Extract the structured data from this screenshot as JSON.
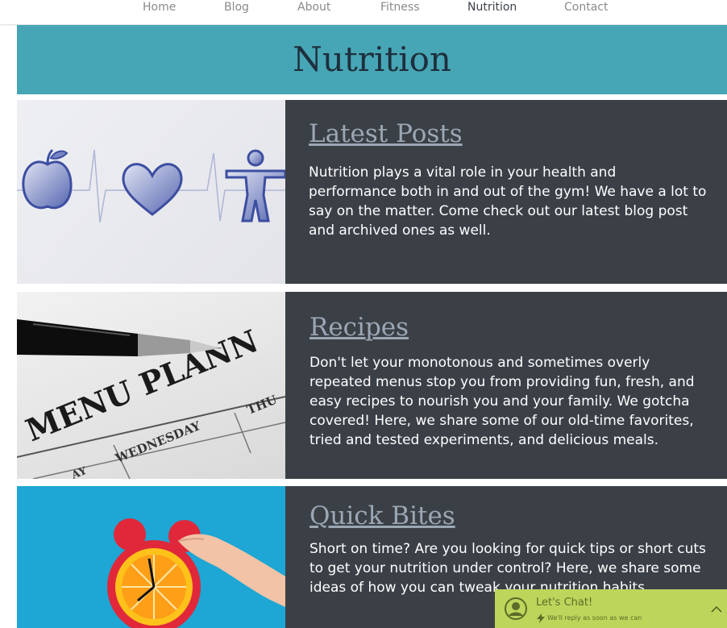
{
  "nav": {
    "items": [
      {
        "label": "Home"
      },
      {
        "label": "Blog"
      },
      {
        "label": "About"
      },
      {
        "label": "Fitness"
      },
      {
        "label": "Nutrition"
      },
      {
        "label": "Contact"
      }
    ],
    "active": "Nutrition"
  },
  "banner": {
    "title": "Nutrition"
  },
  "sections": [
    {
      "title": "Latest Posts",
      "description": "Nutrition plays a vital role in your health and performance both in and out of the gym! We have a lot to say on the matter. Come check out our latest blog post and archived ones as well.",
      "image_icon": "apple-heartbeat-person-image"
    },
    {
      "title": "Recipes",
      "description": "Don't let your monotonous and sometimes overly repeated menus stop you from providing fun, fresh, and easy recipes to nourish you and your family. We gotcha covered! Here, we share some of our old-time favorites, tried and tested experiments, and delicious meals.",
      "image_icon": "menu-planner-pen-image",
      "image_text": {
        "menu": "MENU PLANN",
        "wednesday": "WEDNESDAY",
        "thu": "THU",
        "day": "AY"
      }
    },
    {
      "title": "Quick Bites",
      "description": "Short on time? Are you looking for quick tips or short cuts to get your nutrition under control? Here, we share some ideas of how you can tweak your nutrition habits.",
      "image_icon": "alarm-clock-orange-image"
    }
  ],
  "chat": {
    "title": "Let's Chat!",
    "subtitle": "We'll reply as soon as we can"
  },
  "colors": {
    "banner": "#47a6b5",
    "panel": "#3b4047",
    "link": "#9ca7b4",
    "chat": "#bcd65b"
  }
}
